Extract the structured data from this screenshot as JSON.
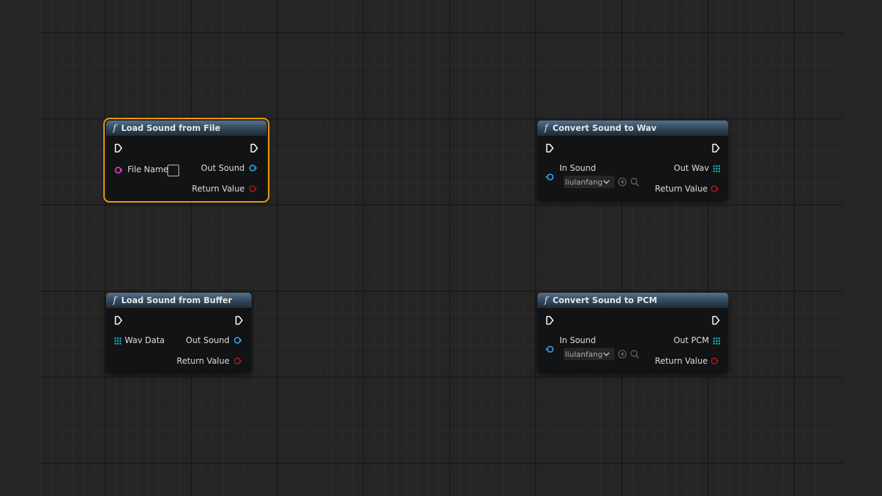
{
  "nodes": {
    "load_file": {
      "title": "Load Sound from File",
      "file_name_label": "File Name",
      "out_sound_label": "Out Sound",
      "return_value_label": "Return Value"
    },
    "convert_wav": {
      "title": "Convert Sound to Wav",
      "in_sound_label": "In Sound",
      "asset_value": "liulanfang",
      "out_wav_label": "Out Wav",
      "return_value_label": "Return Value"
    },
    "load_buffer": {
      "title": "Load Sound from Buffer",
      "wav_data_label": "Wav Data",
      "out_sound_label": "Out Sound",
      "return_value_label": "Return Value"
    },
    "convert_pcm": {
      "title": "Convert Sound to PCM",
      "in_sound_label": "In Sound",
      "asset_value": "liulanfang",
      "out_pcm_label": "Out PCM",
      "return_value_label": "Return Value"
    }
  },
  "function_icon": "f",
  "colors": {
    "selection_outline": "#f29d12",
    "string_pin": "#e040d9",
    "object_pin": "#2aa2e8",
    "bool_pin": "#a0181c",
    "byte_array_pin": "#1ca5b2",
    "exec_pin": "#ffffff"
  }
}
